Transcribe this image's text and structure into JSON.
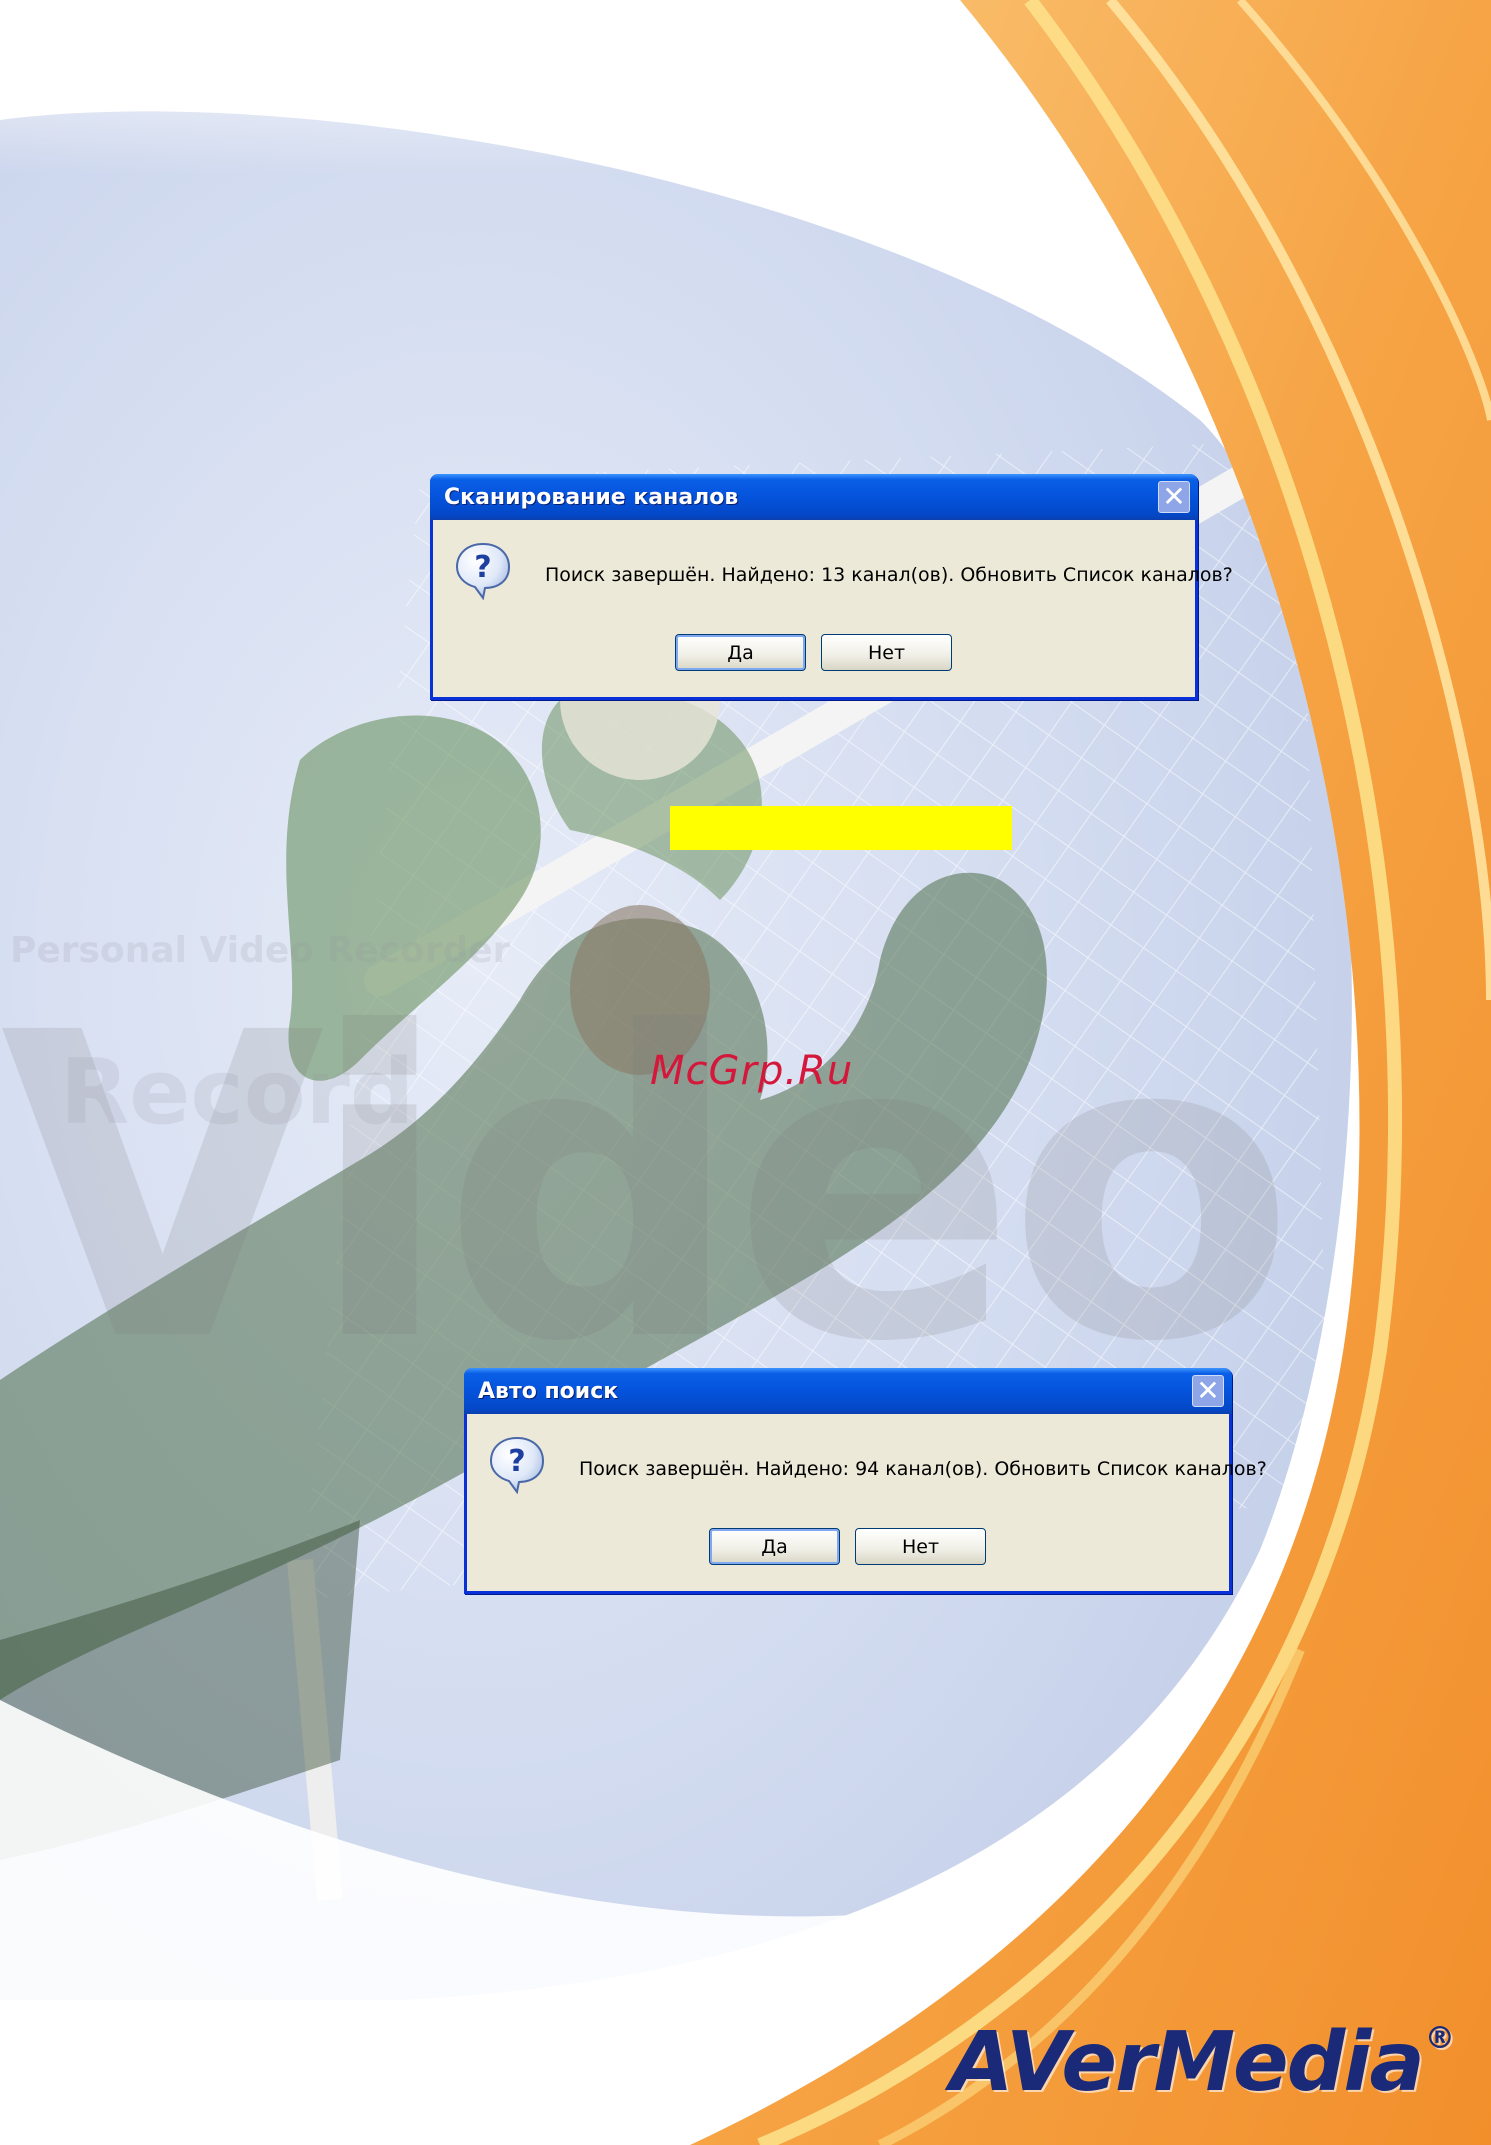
{
  "dialogs": [
    {
      "title": "Сканирование каналов",
      "message": "Поиск завершён. Найдено: 13 канал(ов). Обновить Список каналов?",
      "buttons": {
        "yes": "Да",
        "no": "Нет"
      },
      "close_label": "✕"
    },
    {
      "title": "Авто поиск",
      "message": "Поиск завершён. Найдено: 94 канал(ов). Обновить Список каналов?",
      "buttons": {
        "yes": "Да",
        "no": "Нет"
      },
      "close_label": "✕"
    }
  ],
  "watermark": "McGrp.Ru",
  "brand": {
    "name": "AVerMedia",
    "reg": "®"
  },
  "background_text": {
    "big_word": "Video",
    "line1": "Personal Video Recorder",
    "line2": "Record"
  },
  "colors": {
    "title_bar": "#0553dc",
    "dialog_face": "#ece9d8",
    "highlight": "#ffff00",
    "watermark": "#d4183c",
    "brand": "#1b2a78",
    "orange_band": "#f5a23a"
  }
}
